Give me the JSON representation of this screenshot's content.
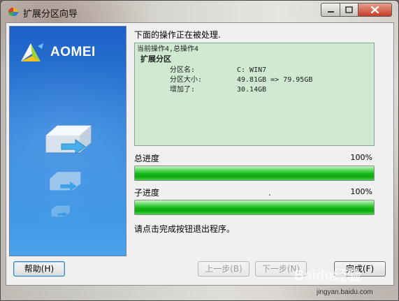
{
  "window": {
    "title": "扩展分区向导"
  },
  "brand": {
    "name": "AOMEI"
  },
  "main": {
    "heading": "下面的操作正在被处理.",
    "log": {
      "current_op": "当前操作4,总操作4",
      "op_title": "扩展分区",
      "rows": [
        {
          "label": "分区名:",
          "value": "C: WIN7"
        },
        {
          "label": "分区大小:",
          "value": "49.81GB => 79.95GB"
        },
        {
          "label": "增加了:",
          "value": "30.14GB"
        }
      ]
    },
    "total_progress": {
      "label": "总进度",
      "percent_text": "100%",
      "value": 100
    },
    "sub_progress": {
      "label": "子进度",
      "status": ".",
      "percent_text": "100%",
      "value": 100
    },
    "hint": "请点击完成按钮退出程序。"
  },
  "buttons": {
    "help": "帮助(H)",
    "back": "上一步(B)",
    "next": "下一步(N)",
    "finish": "完成(F)"
  },
  "watermark": {
    "text": "Baidu经验",
    "url": "jingyan.baidu.com"
  }
}
